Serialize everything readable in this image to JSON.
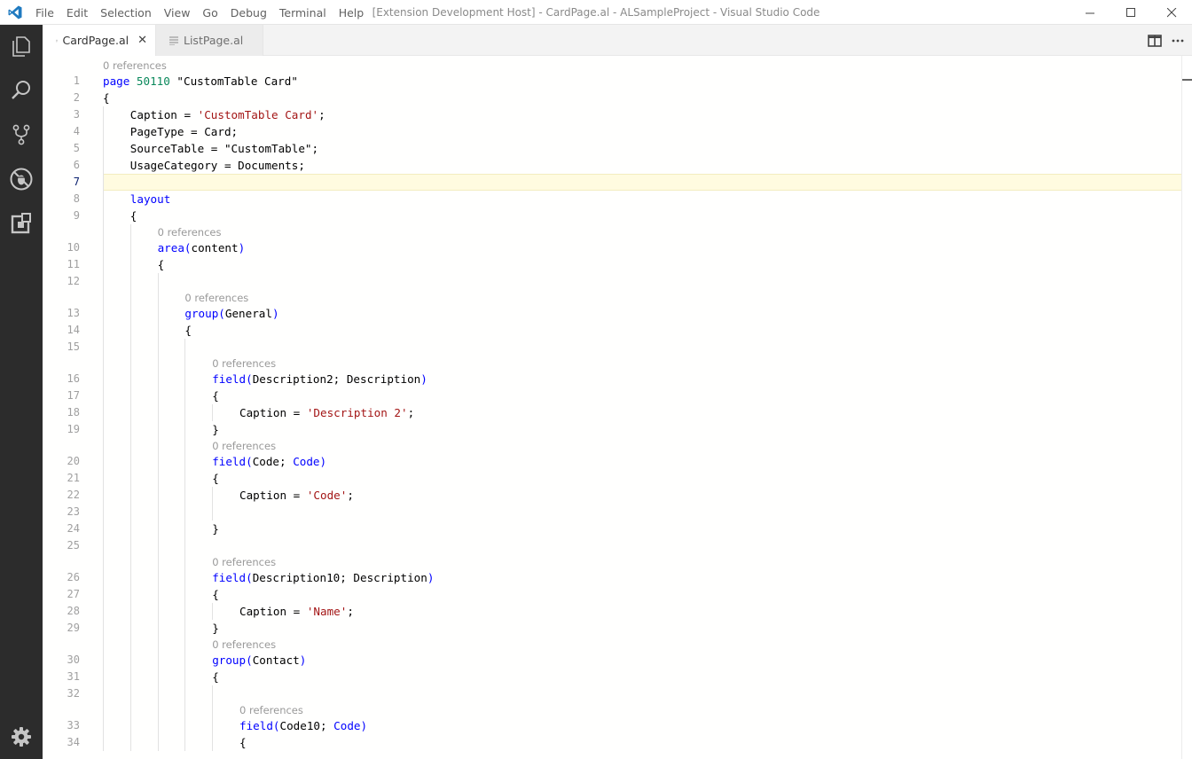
{
  "titlebar": {
    "title": "[Extension Development Host] - CardPage.al - ALSampleProject - Visual Studio Code",
    "menu": [
      "File",
      "Edit",
      "Selection",
      "View",
      "Go",
      "Debug",
      "Terminal",
      "Help"
    ]
  },
  "activity_bar": {
    "icons": [
      "explorer-icon",
      "search-icon",
      "source-control-icon",
      "debug-icon",
      "extensions-icon",
      "gear-icon"
    ]
  },
  "tabs": [
    {
      "label": "CardPage.al",
      "active": true
    },
    {
      "label": "ListPage.al",
      "active": false
    }
  ],
  "editor": {
    "codelens_text": "0 references",
    "current_line": 7,
    "lines": [
      {
        "n": "1",
        "lens_before": true,
        "indent": 0,
        "tokens": [
          [
            "kw",
            "page "
          ],
          [
            "num",
            "50110 "
          ],
          [
            "id",
            "\"CustomTable Card\""
          ]
        ]
      },
      {
        "n": "2",
        "indent": 0,
        "tokens": [
          [
            "id",
            "{"
          ]
        ]
      },
      {
        "n": "3",
        "indent": 1,
        "tokens": [
          [
            "id",
            "Caption = "
          ],
          [
            "str",
            "'CustomTable Card'"
          ],
          [
            "id",
            ";"
          ]
        ]
      },
      {
        "n": "4",
        "indent": 1,
        "tokens": [
          [
            "id",
            "PageType = Card;"
          ]
        ]
      },
      {
        "n": "5",
        "indent": 1,
        "tokens": [
          [
            "id",
            "SourceTable = \"CustomTable\";"
          ]
        ]
      },
      {
        "n": "6",
        "indent": 1,
        "tokens": [
          [
            "id",
            "UsageCategory = Documents;"
          ]
        ]
      },
      {
        "n": "7",
        "indent": 0,
        "tokens": []
      },
      {
        "n": "8",
        "indent": 1,
        "tokens": [
          [
            "kw",
            "layout"
          ]
        ]
      },
      {
        "n": "9",
        "indent": 1,
        "tokens": [
          [
            "id",
            "{"
          ]
        ]
      },
      {
        "n": "10",
        "lens_before": true,
        "indent": 2,
        "tokens": [
          [
            "kw",
            "area("
          ],
          [
            "id",
            "content"
          ],
          [
            "kw",
            ")"
          ]
        ]
      },
      {
        "n": "11",
        "indent": 2,
        "tokens": [
          [
            "id",
            "{"
          ]
        ]
      },
      {
        "n": "12",
        "indent": 0,
        "tokens": []
      },
      {
        "n": "13",
        "lens_before": true,
        "indent": 3,
        "tokens": [
          [
            "kw",
            "group("
          ],
          [
            "id",
            "General"
          ],
          [
            "kw",
            ")"
          ]
        ]
      },
      {
        "n": "14",
        "indent": 3,
        "tokens": [
          [
            "id",
            "{"
          ]
        ]
      },
      {
        "n": "15",
        "indent": 0,
        "tokens": []
      },
      {
        "n": "16",
        "lens_before": true,
        "indent": 4,
        "tokens": [
          [
            "kw",
            "field("
          ],
          [
            "id",
            "Description2; Description"
          ],
          [
            "kw",
            ")"
          ]
        ]
      },
      {
        "n": "17",
        "indent": 4,
        "tokens": [
          [
            "id",
            "{"
          ]
        ]
      },
      {
        "n": "18",
        "indent": 5,
        "tokens": [
          [
            "id",
            "Caption = "
          ],
          [
            "str",
            "'Description 2'"
          ],
          [
            "id",
            ";"
          ]
        ]
      },
      {
        "n": "19",
        "indent": 4,
        "tokens": [
          [
            "id",
            "}"
          ]
        ]
      },
      {
        "n": "20",
        "lens_before": true,
        "indent": 4,
        "tokens": [
          [
            "kw",
            "field("
          ],
          [
            "id",
            "Code; "
          ],
          [
            "kw",
            "Code)"
          ]
        ]
      },
      {
        "n": "21",
        "indent": 4,
        "tokens": [
          [
            "id",
            "{"
          ]
        ]
      },
      {
        "n": "22",
        "indent": 5,
        "tokens": [
          [
            "id",
            "Caption = "
          ],
          [
            "str",
            "'Code'"
          ],
          [
            "id",
            ";"
          ]
        ]
      },
      {
        "n": "23",
        "indent": 0,
        "tokens": []
      },
      {
        "n": "24",
        "indent": 4,
        "tokens": [
          [
            "id",
            "}"
          ]
        ]
      },
      {
        "n": "25",
        "indent": 0,
        "tokens": []
      },
      {
        "n": "26",
        "lens_before": true,
        "indent": 4,
        "tokens": [
          [
            "kw",
            "field("
          ],
          [
            "id",
            "Description10; Description"
          ],
          [
            "kw",
            ")"
          ]
        ]
      },
      {
        "n": "27",
        "indent": 4,
        "tokens": [
          [
            "id",
            "{"
          ]
        ]
      },
      {
        "n": "28",
        "indent": 5,
        "tokens": [
          [
            "id",
            "Caption = "
          ],
          [
            "str",
            "'Name'"
          ],
          [
            "id",
            ";"
          ]
        ]
      },
      {
        "n": "29",
        "indent": 4,
        "tokens": [
          [
            "id",
            "}"
          ]
        ]
      },
      {
        "n": "30",
        "lens_before": true,
        "indent": 4,
        "tokens": [
          [
            "kw",
            "group("
          ],
          [
            "id",
            "Contact"
          ],
          [
            "kw",
            ")"
          ]
        ]
      },
      {
        "n": "31",
        "indent": 4,
        "tokens": [
          [
            "id",
            "{"
          ]
        ]
      },
      {
        "n": "32",
        "indent": 0,
        "tokens": []
      },
      {
        "n": "33",
        "lens_before": true,
        "indent": 5,
        "tokens": [
          [
            "kw",
            "field("
          ],
          [
            "id",
            "Code10; "
          ],
          [
            "kw",
            "Code)"
          ]
        ]
      },
      {
        "n": "34",
        "indent": 5,
        "tokens": [
          [
            "id",
            "{"
          ]
        ]
      }
    ]
  },
  "colors": {
    "keyword": "#0000ff",
    "number": "#09885a",
    "string": "#a31515",
    "activity_bar": "#2c2c2c",
    "current_line": "#fffbe0"
  }
}
